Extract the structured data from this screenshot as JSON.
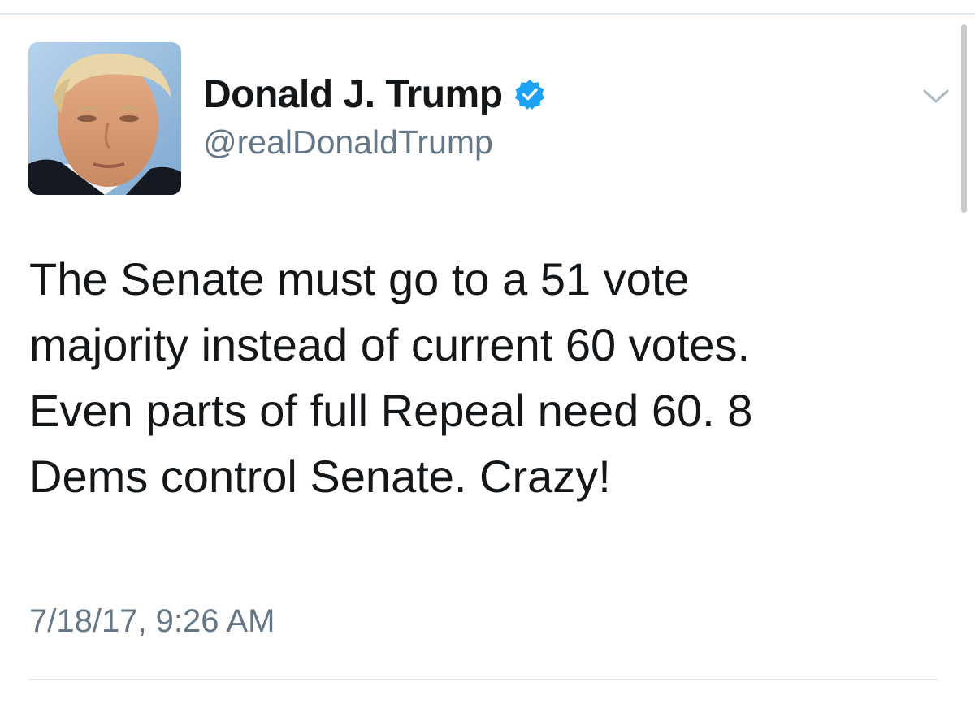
{
  "tweet": {
    "author": {
      "display_name": "Donald J. Trump",
      "username": "@realDonaldTrump",
      "verified": true,
      "avatar_icon": "profile-photo"
    },
    "text_lines": [
      "The Senate must go to a 51 vote",
      "majority instead of current 60 votes.",
      "Even parts of full Repeal need 60. 8",
      "Dems control Senate. Crazy!"
    ],
    "timestamp": "7/18/17, 9:26 AM",
    "menu_icon": "chevron-down-icon"
  },
  "colors": {
    "text_primary": "#14171a",
    "text_secondary": "#657786",
    "verified_blue": "#1da1f2",
    "divider": "#e1e8ed"
  }
}
